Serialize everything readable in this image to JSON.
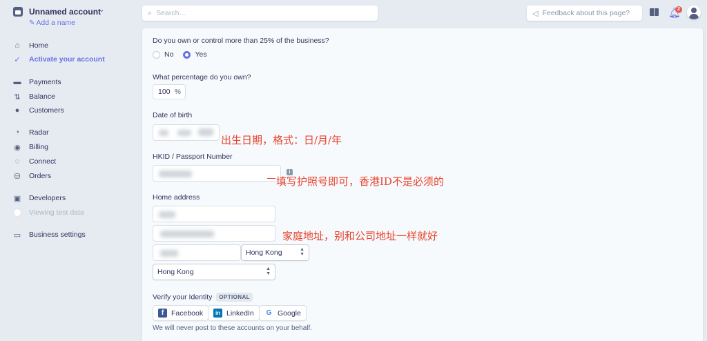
{
  "account": {
    "name": "Unnamed account",
    "add_name": "Add a name"
  },
  "nav": {
    "home": "Home",
    "activate": "Activate your account",
    "payments": "Payments",
    "balance": "Balance",
    "customers": "Customers",
    "radar": "Radar",
    "billing": "Billing",
    "connect": "Connect",
    "orders": "Orders",
    "developers": "Developers",
    "test_data": "Viewing test data",
    "business_settings": "Business settings"
  },
  "topbar": {
    "search_placeholder": "Search…",
    "feedback": "Feedback about this page?",
    "notification_count": "2"
  },
  "form": {
    "ownership_question": "Do you own or control more than 25% of the business?",
    "option_no": "No",
    "option_yes": "Yes",
    "selected_option": "Yes",
    "percentage_question": "What percentage do you own?",
    "percentage_value": "100",
    "percentage_unit": "%",
    "dob_label": "Date of birth",
    "id_label": "HKID / Passport Number",
    "address_label": "Home address",
    "address_line2_partial": "",
    "city_partial": "",
    "region_select": "Hong Kong",
    "country_select": "Hong Kong",
    "verify_label": "Verify your Identity",
    "optional_badge": "OPTIONAL",
    "facebook": "Facebook",
    "linkedin": "LinkedIn",
    "google": "Google",
    "privacy_note": "We will never post to these accounts on your behalf."
  },
  "annotations": {
    "dob_note": "出生日期，格式：日/月/年",
    "id_note": "填写护照号即可，香港ID不是必须的",
    "address_note": "家庭地址，别和公司地址一样就好"
  },
  "colors": {
    "accent": "#6772e5",
    "annotation": "#e8432e",
    "sidebar_bg": "#e6ebf1",
    "panel_bg": "#f7fafc"
  }
}
